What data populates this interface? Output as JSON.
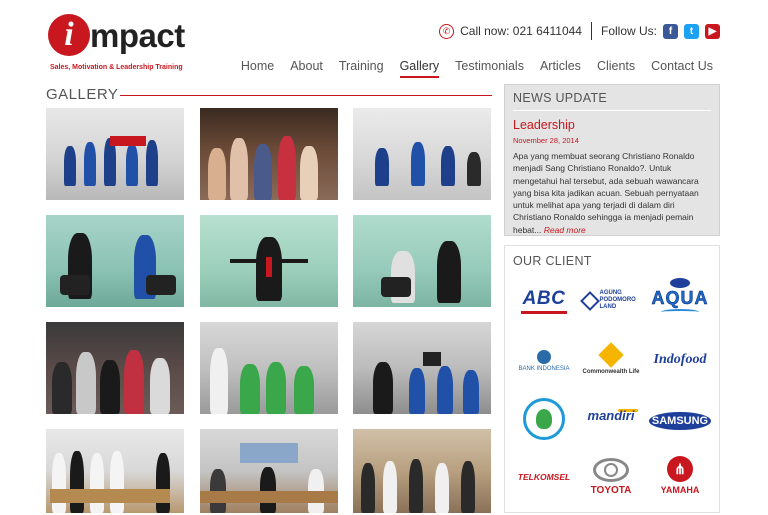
{
  "brand": {
    "logo_letter": "i",
    "logo_word": "mpact",
    "tagline": "Sales, Motivation & Leadership Training"
  },
  "contact": {
    "phone": "Call now: 021 6411044",
    "follow": "Follow Us:"
  },
  "nav": {
    "items": [
      "Home",
      "About",
      "Training",
      "Gallery",
      "Testimonials",
      "Articles",
      "Clients",
      "Contact Us"
    ],
    "active": "Gallery"
  },
  "gallery": {
    "title": "GALLERY",
    "photo_count": 12
  },
  "news": {
    "title": "NEWS UPDATE",
    "headline": "Leadership",
    "date": "November 28, 2014",
    "body": "Apa yang membuat seorang Christiano Ronaldo menjadi Sang Christiano Ronaldo?. Untuk mengetahui hal tersebut, ada sebuah wawancara yang bisa kita jadikan acuan. Sebuah pernyataan untuk melihat apa yang terjadi di dalam diri Christiano Ronaldo sehingga ia menjadi pemain hebat...",
    "more": "Read more"
  },
  "clients": {
    "title": "OUR CLIENT",
    "logos": [
      "ABC",
      "AGUNG PODOMORO LAND",
      "AQUA",
      "BANK INDONESIA",
      "Commonwealth Life",
      "Indofood",
      "",
      "mandiri",
      "SAMSUNG",
      "TELKOMSEL",
      "TOYOTA",
      "YAMAHA"
    ]
  },
  "colors": {
    "accent": "#c8171e",
    "sidebar_bg": "#e4e4e4"
  }
}
